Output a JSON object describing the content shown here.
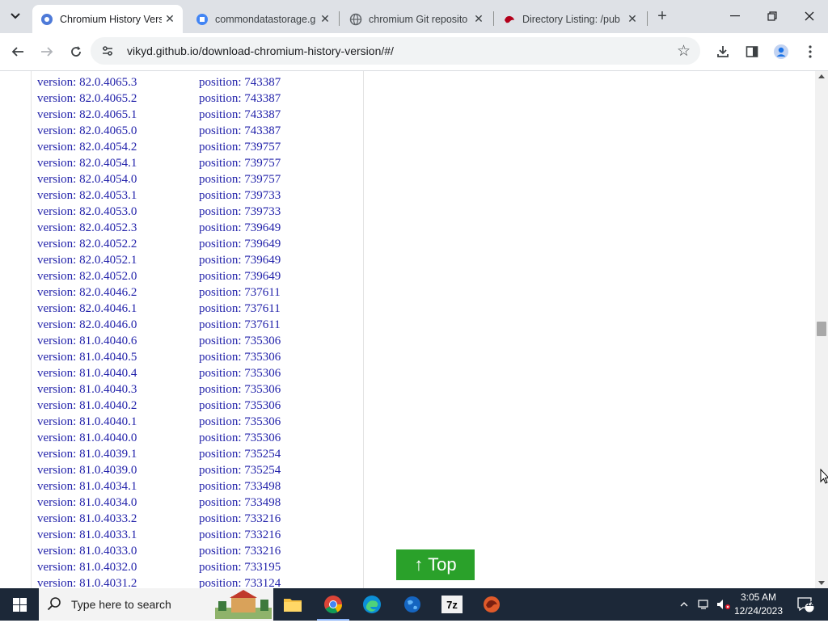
{
  "browser": {
    "tabs": [
      {
        "title": "Chromium History Versions",
        "active": true,
        "icon": "chromium-icon"
      },
      {
        "title": "commondatastorage.g",
        "active": false,
        "icon": "doc-icon"
      },
      {
        "title": "chromium Git reposito",
        "active": false,
        "icon": "globe-icon"
      },
      {
        "title": "Directory Listing: /pub",
        "active": false,
        "icon": "bird-icon"
      }
    ],
    "url": "vikyd.github.io/download-chromium-history-version/#/"
  },
  "page": {
    "rows": [
      {
        "version": "version: 82.0.4065.3",
        "position": "position: 743387"
      },
      {
        "version": "version: 82.0.4065.2",
        "position": "position: 743387"
      },
      {
        "version": "version: 82.0.4065.1",
        "position": "position: 743387"
      },
      {
        "version": "version: 82.0.4065.0",
        "position": "position: 743387"
      },
      {
        "version": "version: 82.0.4054.2",
        "position": "position: 739757"
      },
      {
        "version": "version: 82.0.4054.1",
        "position": "position: 739757"
      },
      {
        "version": "version: 82.0.4054.0",
        "position": "position: 739757"
      },
      {
        "version": "version: 82.0.4053.1",
        "position": "position: 739733"
      },
      {
        "version": "version: 82.0.4053.0",
        "position": "position: 739733"
      },
      {
        "version": "version: 82.0.4052.3",
        "position": "position: 739649"
      },
      {
        "version": "version: 82.0.4052.2",
        "position": "position: 739649"
      },
      {
        "version": "version: 82.0.4052.1",
        "position": "position: 739649"
      },
      {
        "version": "version: 82.0.4052.0",
        "position": "position: 739649"
      },
      {
        "version": "version: 82.0.4046.2",
        "position": "position: 737611"
      },
      {
        "version": "version: 82.0.4046.1",
        "position": "position: 737611"
      },
      {
        "version": "version: 82.0.4046.0",
        "position": "position: 737611"
      },
      {
        "version": "version: 81.0.4040.6",
        "position": "position: 735306"
      },
      {
        "version": "version: 81.0.4040.5",
        "position": "position: 735306"
      },
      {
        "version": "version: 81.0.4040.4",
        "position": "position: 735306"
      },
      {
        "version": "version: 81.0.4040.3",
        "position": "position: 735306"
      },
      {
        "version": "version: 81.0.4040.2",
        "position": "position: 735306"
      },
      {
        "version": "version: 81.0.4040.1",
        "position": "position: 735306"
      },
      {
        "version": "version: 81.0.4040.0",
        "position": "position: 735306"
      },
      {
        "version": "version: 81.0.4039.1",
        "position": "position: 735254"
      },
      {
        "version": "version: 81.0.4039.0",
        "position": "position: 735254"
      },
      {
        "version": "version: 81.0.4034.1",
        "position": "position: 733498"
      },
      {
        "version": "version: 81.0.4034.0",
        "position": "position: 733498"
      },
      {
        "version": "version: 81.0.4033.2",
        "position": "position: 733216"
      },
      {
        "version": "version: 81.0.4033.1",
        "position": "position: 733216"
      },
      {
        "version": "version: 81.0.4033.0",
        "position": "position: 733216"
      },
      {
        "version": "version: 81.0.4032.0",
        "position": "position: 733195"
      },
      {
        "version": "version: 81.0.4031.2",
        "position": "position: 733124"
      }
    ],
    "top_button": "↑ Top",
    "link_color": "#2222aa",
    "top_button_color": "#2aa12a"
  },
  "taskbar": {
    "search_placeholder": "Type here to search",
    "time": "3:05 AM",
    "date": "12/24/2023",
    "notification_count": "12",
    "apps": [
      "file-explorer-icon",
      "chrome-icon",
      "edge-icon",
      "globe-app-icon",
      "7zip-icon",
      "bird-app-icon"
    ]
  }
}
